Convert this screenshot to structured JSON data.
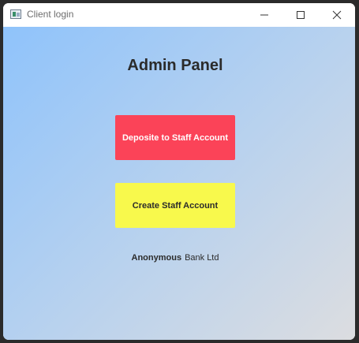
{
  "window": {
    "title": "Client login"
  },
  "titlebar_buttons": {
    "minimize": "minimize-icon",
    "maximize": "maximize-icon",
    "close": "close-icon"
  },
  "main": {
    "heading": "Admin Panel",
    "deposit_button_label": "Deposite to Staff Account",
    "create_button_label": "Create Staff Account",
    "footer_brand_bold": "Anonymous",
    "footer_brand_plain": "Bank Ltd"
  },
  "colors": {
    "deposit_button": "#fb4358",
    "create_button": "#f8f94c",
    "gradient_start": "#8fc3fb",
    "gradient_end": "#dcdde0"
  }
}
